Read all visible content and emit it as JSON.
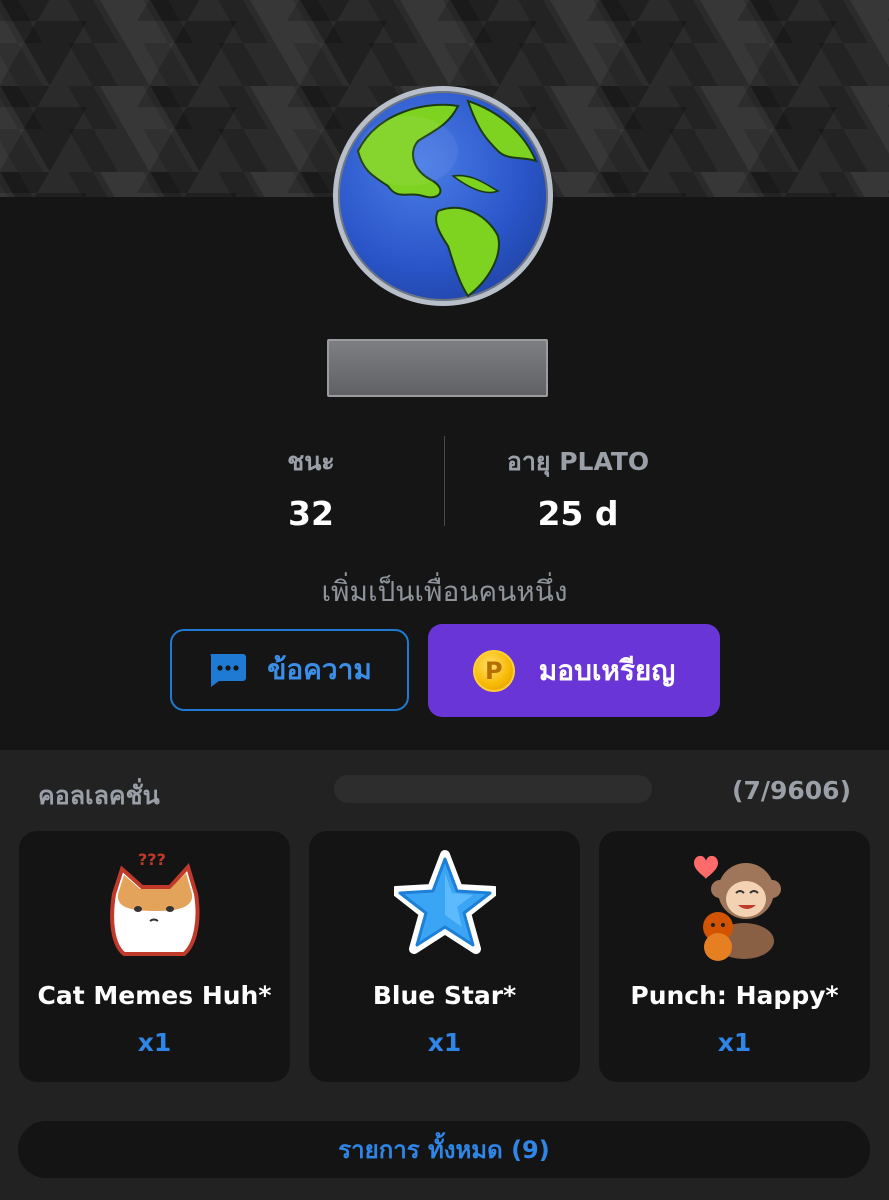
{
  "profile": {
    "stats": [
      {
        "label": "ชนะ",
        "value": "32"
      },
      {
        "label": "อายุ PLATO",
        "value": "25 d"
      }
    ],
    "friend_text": "เพิ่มเป็นเพื่อนคนหนึ่ง",
    "message_button": "ข้อความ",
    "coin_button": "มอบเหรียญ",
    "coin_glyph": "P"
  },
  "collection": {
    "title": "คอลเลคชั่น",
    "count": "(7/9606)",
    "items": [
      {
        "name": "Cat Memes Huh*",
        "count": "x1",
        "badge": "???"
      },
      {
        "name": "Blue Star*",
        "count": "x1"
      },
      {
        "name": "Punch: Happy*",
        "count": "x1"
      }
    ],
    "all_button": "รายการ ทั้งหมด (9)"
  },
  "colors": {
    "accent_purple": "#6a35d6",
    "accent_blue": "#2f86e6",
    "background": "#151515"
  }
}
